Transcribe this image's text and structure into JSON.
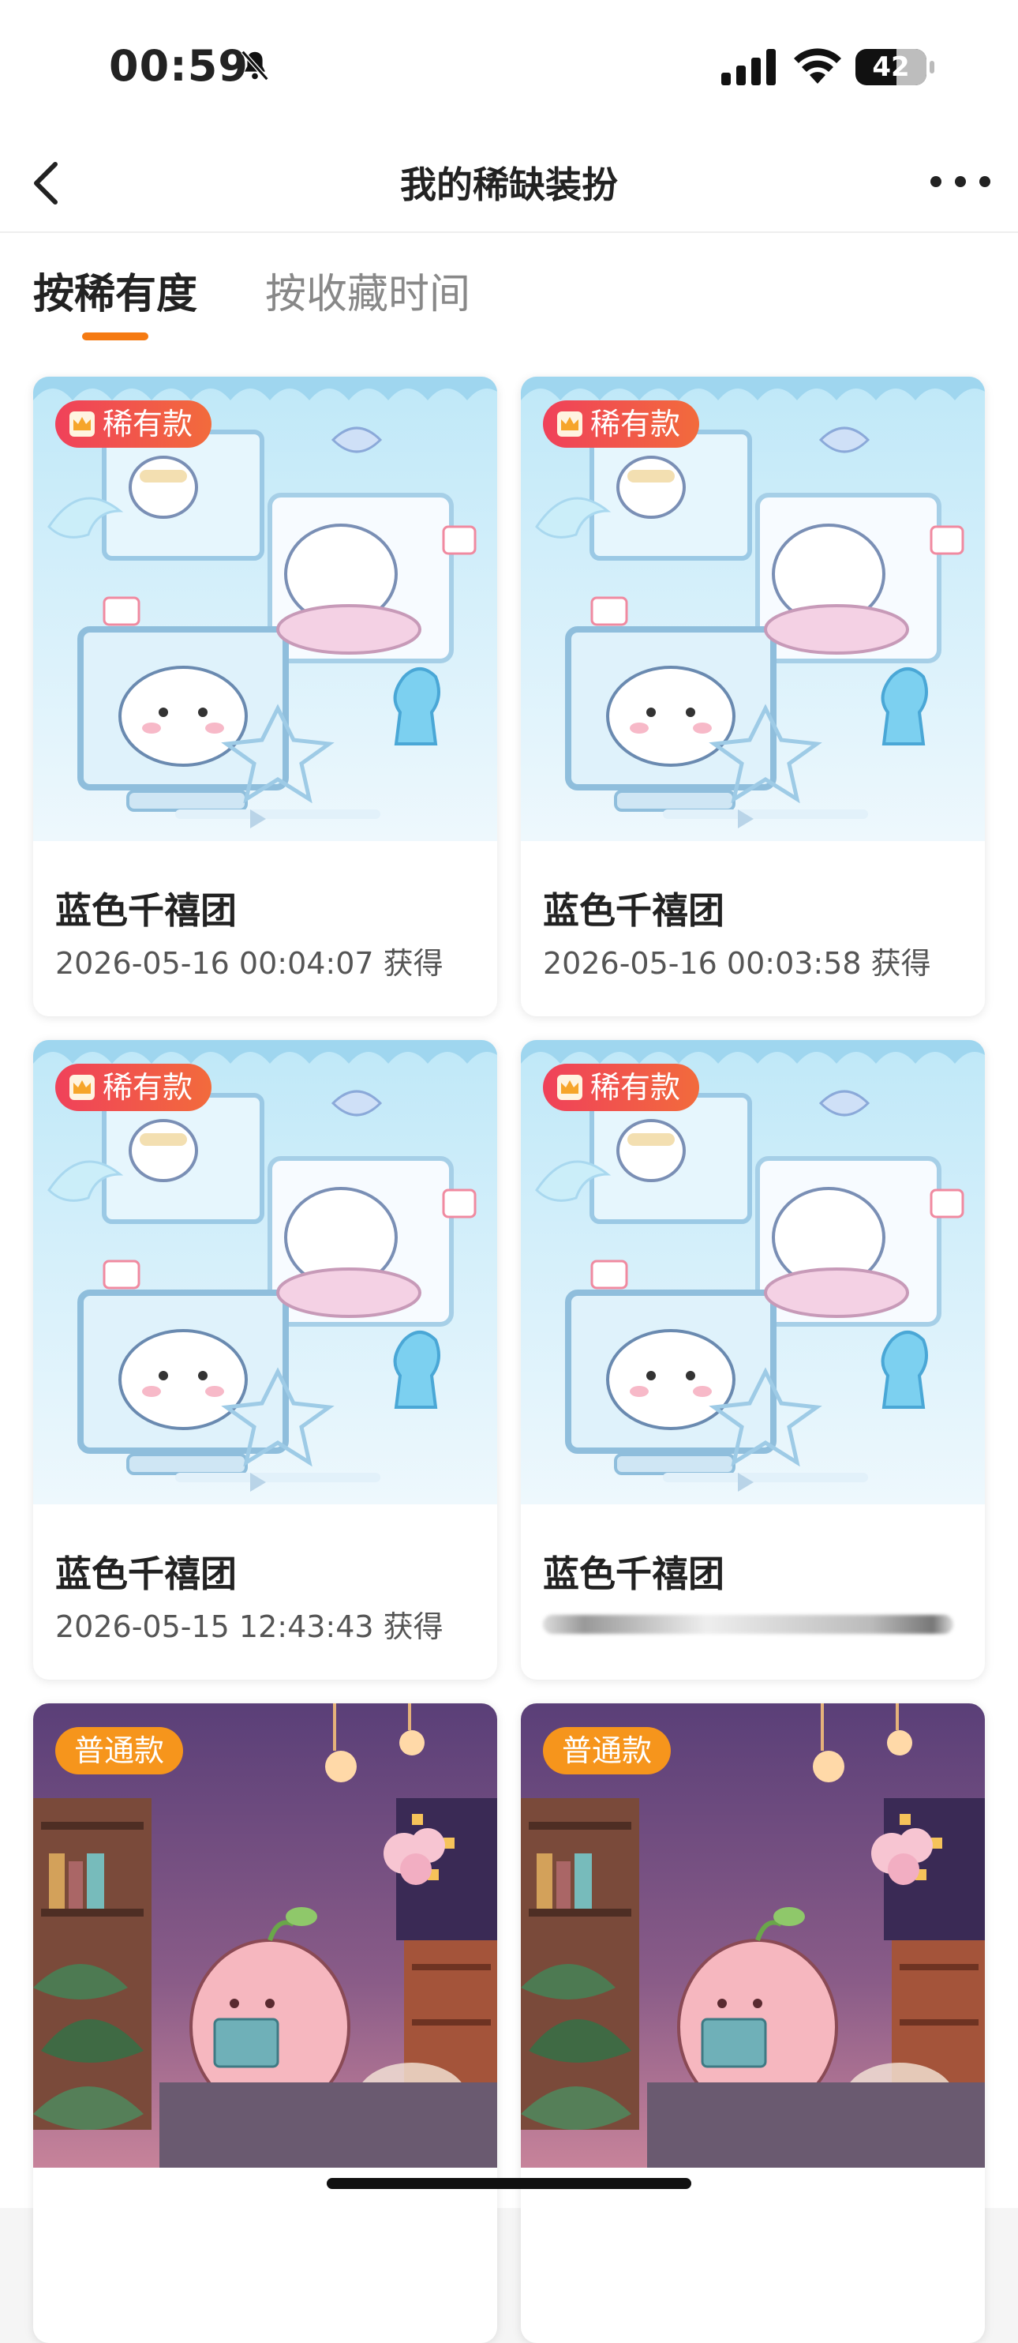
{
  "status_bar": {
    "time": "00:59",
    "battery": "42"
  },
  "nav": {
    "title": "我的稀缺装扮"
  },
  "tabs": [
    {
      "label": "按稀有度",
      "active": true
    },
    {
      "label": "按收藏时间",
      "active": false
    }
  ],
  "cards": [
    {
      "badge": "稀有款",
      "name": "蓝色千禧团",
      "date": "2026-05-16 00:04:07 获得"
    },
    {
      "badge": "稀有款",
      "name": "蓝色千禧团",
      "date": "2026-05-16 00:03:58 获得"
    },
    {
      "badge": "稀有款",
      "name": "蓝色千禧团",
      "date": "2026-05-15 12:43:43 获得"
    },
    {
      "badge": "稀有款",
      "name": "蓝色千禧团",
      "date": ""
    },
    {
      "badge": "普通款",
      "name": "",
      "date": ""
    },
    {
      "badge": "普通款",
      "name": "",
      "date": ""
    }
  ],
  "colors": {
    "accent": "#f57a12",
    "rare_badge": "#f0415a",
    "normal_badge": "#f6951c"
  }
}
